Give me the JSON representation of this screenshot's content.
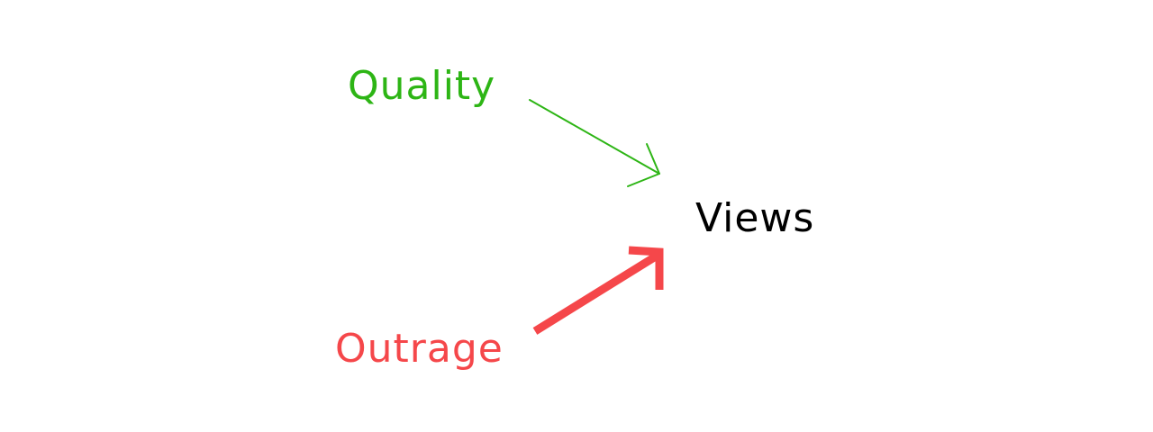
{
  "nodes": {
    "quality": {
      "label": "Quality",
      "color": "#2db515"
    },
    "outrage": {
      "label": "Outrage",
      "color": "#f5474a"
    },
    "views": {
      "label": "Views",
      "color": "#000000"
    }
  },
  "edges": [
    {
      "from": "quality",
      "to": "views",
      "color": "#2db515",
      "weight": "thin"
    },
    {
      "from": "outrage",
      "to": "views",
      "color": "#f5474a",
      "weight": "thick"
    }
  ]
}
